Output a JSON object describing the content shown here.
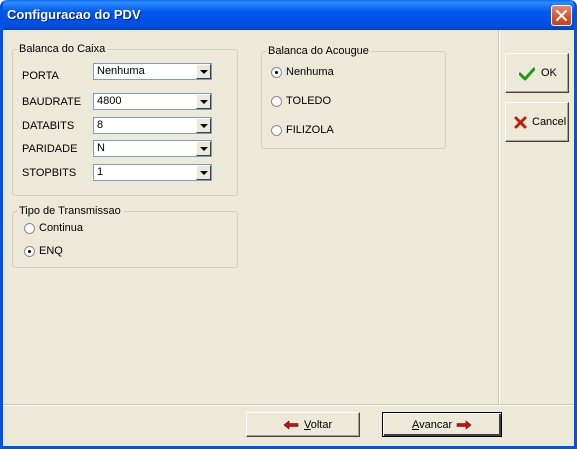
{
  "window": {
    "title": "Configuracao do PDV"
  },
  "balanca_caixa": {
    "legend": "Balanca do Caixa",
    "fields": [
      {
        "label": "PORTA",
        "value": "Nenhuma"
      },
      {
        "label": "BAUDRATE",
        "value": "4800"
      },
      {
        "label": "DATABITS",
        "value": "8"
      },
      {
        "label": "PARIDADE",
        "value": "N"
      },
      {
        "label": "STOPBITS",
        "value": "1"
      }
    ]
  },
  "tipo_transmissao": {
    "legend": "Tipo de Transmissao",
    "options": [
      {
        "label": "Continua",
        "selected": false
      },
      {
        "label": "ENQ",
        "selected": true
      }
    ]
  },
  "balanca_acougue": {
    "legend": "Balanca do Acougue",
    "options": [
      {
        "label": "Nenhuma",
        "selected": true
      },
      {
        "label": "TOLEDO",
        "selected": false
      },
      {
        "label": "FILIZOLA",
        "selected": false
      }
    ]
  },
  "buttons": {
    "ok": "OK",
    "cancel": "Cancel",
    "voltar_underline": "V",
    "voltar_rest": "oltar",
    "avancar_underline": "A",
    "avancar_rest": "vancar"
  },
  "colors": {
    "titlebar": "#0058ee",
    "face": "#ece9d8",
    "ok_check": "#1f9a1f",
    "cancel_x": "#c0200a",
    "arrow": "#d01010"
  }
}
